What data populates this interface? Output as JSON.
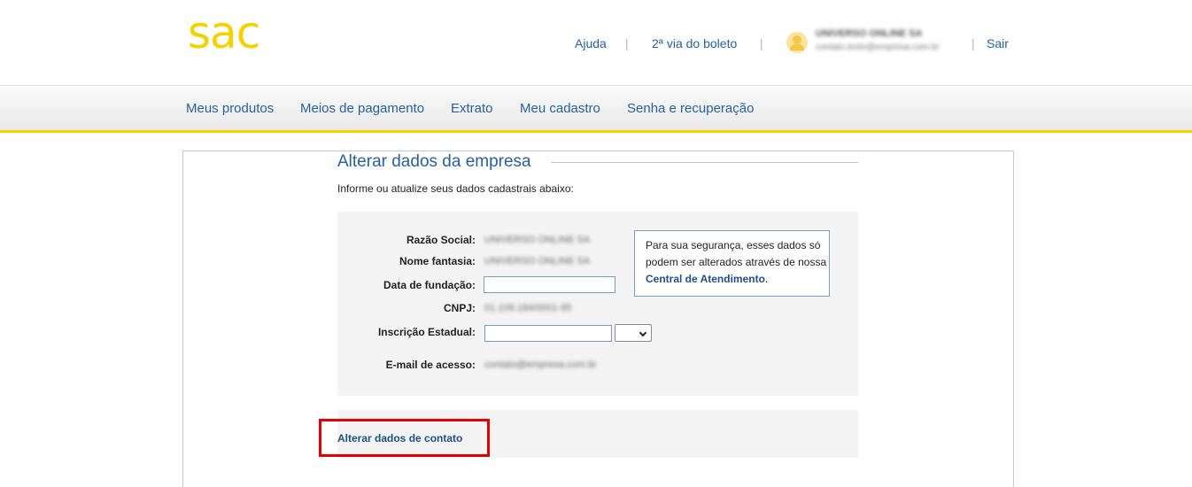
{
  "header": {
    "logo": "sac",
    "links": {
      "ajuda": "Ajuda",
      "boleto": "2ª via do boleto",
      "sair": "Sair",
      "separator": "|"
    },
    "user": {
      "name": "UNIVERSO ONLINE SA",
      "email": "contato.teste@empresa.com.br"
    }
  },
  "nav": {
    "items": [
      "Meus produtos",
      "Meios de pagamento",
      "Extrato",
      "Meu cadastro",
      "Senha e recuperação"
    ]
  },
  "page": {
    "title": "Alterar dados da empresa",
    "subtitle": "Informe ou atualize seus dados cadastrais abaixo:"
  },
  "form": {
    "razao_social": {
      "label": "Razão Social:",
      "value": "UNIVERSO ONLINE SA"
    },
    "nome_fantasia": {
      "label": "Nome fantasia:",
      "value": "UNIVERSO ONLINE SA"
    },
    "data_fundacao": {
      "label": "Data de fundação:",
      "value": ""
    },
    "cnpj": {
      "label": "CNPJ:",
      "value": "01.109.184/0001-95"
    },
    "inscricao_estadual": {
      "label": "Inscrição Estadual:",
      "value": "",
      "select_value": ""
    },
    "email": {
      "label": "E-mail de acesso:",
      "value": "contato@empresa.com.br"
    }
  },
  "info_box": {
    "text": "Para sua segurança, esses dados só podem ser alterados através de nossa",
    "link": "Central de Atendimento",
    "suffix": "."
  },
  "contact": {
    "link": "Alterar dados de contato"
  },
  "colors": {
    "brand_yellow": "#f7d000",
    "link_blue": "#2660a4",
    "highlight_red": "#e60000"
  }
}
